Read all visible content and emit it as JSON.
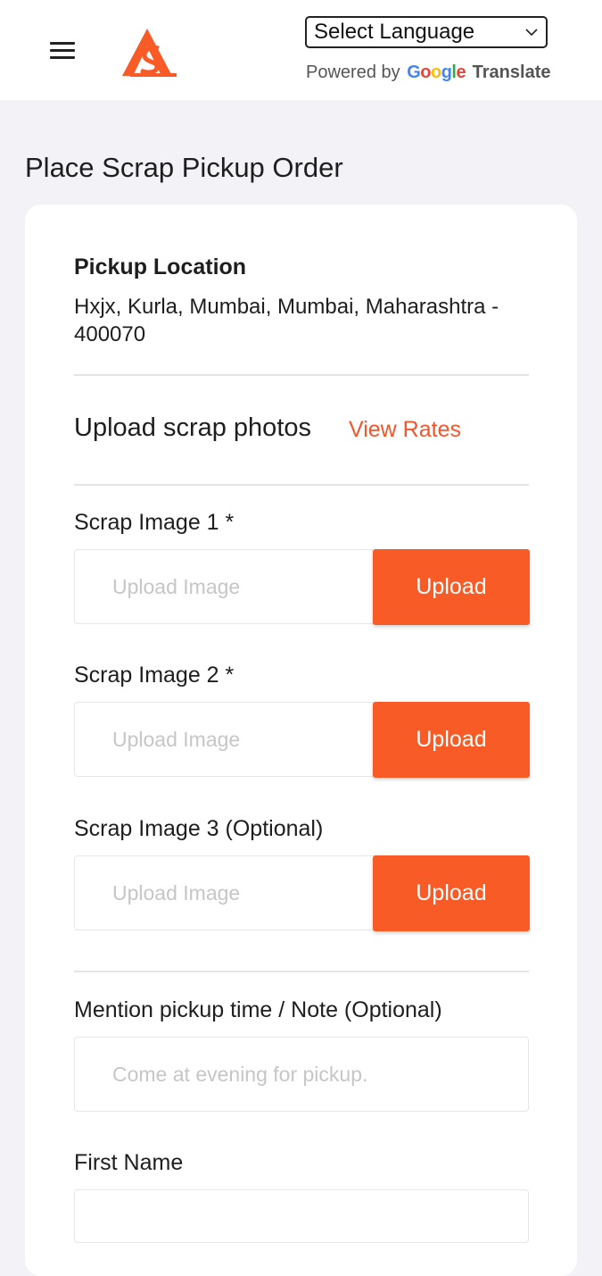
{
  "header": {
    "language_select": "Select Language",
    "powered_by": "Powered by",
    "google": [
      "G",
      "o",
      "o",
      "g",
      "l",
      "e"
    ],
    "translate": "Translate"
  },
  "page_title": "Place Scrap Pickup Order",
  "pickup": {
    "heading": "Pickup Location",
    "address": "Hxjx, Kurla, Mumbai, Mumbai, Maharashtra - 400070"
  },
  "photos": {
    "heading": "Upload scrap photos",
    "view_rates": "View Rates"
  },
  "images": [
    {
      "label": "Scrap Image 1 *",
      "placeholder": "Upload Image",
      "button": "Upload"
    },
    {
      "label": "Scrap Image 2 *",
      "placeholder": "Upload Image",
      "button": "Upload"
    },
    {
      "label": "Scrap Image 3 (Optional)",
      "placeholder": "Upload Image",
      "button": "Upload"
    }
  ],
  "note": {
    "label": "Mention pickup time / Note (Optional)",
    "placeholder": "Come at evening for pickup."
  },
  "first_name": {
    "label": "First Name"
  },
  "colors": {
    "accent": "#f95b27",
    "link": "#f4552a",
    "background": "#f2f2f7"
  }
}
